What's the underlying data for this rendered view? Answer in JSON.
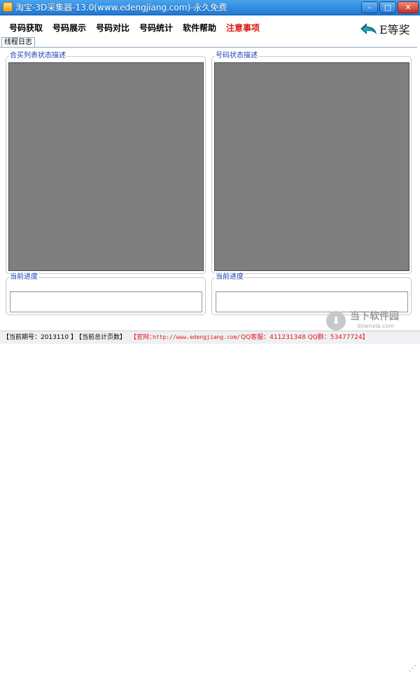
{
  "window": {
    "title": "淘宝-3D采集器-13.0(www.edengjiang.com)-永久免费",
    "buttons": {
      "minimize": "–",
      "maximize": "□",
      "close": "✕"
    }
  },
  "menu": {
    "items": [
      {
        "label": "号码获取"
      },
      {
        "label": "号码展示"
      },
      {
        "label": "号码对比"
      },
      {
        "label": "号码统计"
      },
      {
        "label": "软件帮助"
      },
      {
        "label": "注意事项",
        "color": "#e01818"
      }
    ]
  },
  "logo": {
    "text": "E等奖",
    "icon": "return-arrow-icon",
    "colors": {
      "arrow_dark": "#0f6a7a",
      "arrow_light": "#25a6c4"
    }
  },
  "tabs": [
    {
      "label": "线程日志"
    }
  ],
  "panels": {
    "left": {
      "title": "合买列表状态描述",
      "progress_label": "当前进度",
      "progress_value": ""
    },
    "right": {
      "title": "号码状态描述",
      "progress_label": "当前进度",
      "progress_value": ""
    }
  },
  "status": {
    "period": "【当前期号：2013110 】",
    "pages": "【当前总计页数】",
    "site_prefix": "【官网：",
    "site_url": "http://www.edengjiang.com/",
    "contact": "QQ客服：411231348 QQ群：53477724】"
  },
  "watermark": {
    "text": "当下软件园",
    "domain": "downxia.com",
    "icon": "download-arrow-icon"
  },
  "colors": {
    "titlebar": "#2a85dc",
    "notice": "#e01818",
    "list_bg": "#7f7f7f",
    "group_title": "#1a3fb0"
  }
}
